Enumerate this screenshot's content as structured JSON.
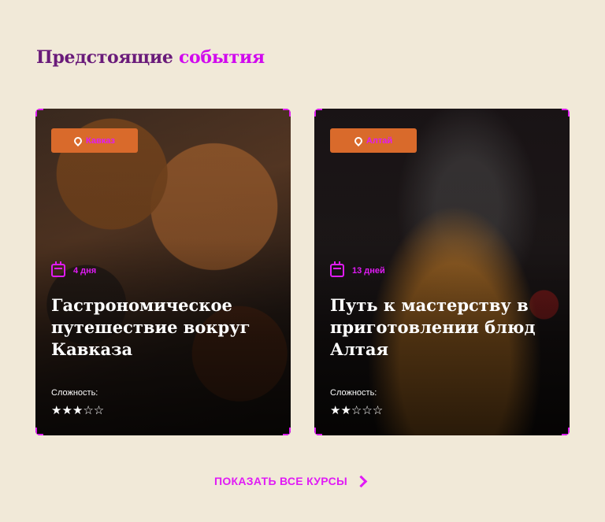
{
  "section": {
    "title_part1": "Предстоящие",
    "title_part2": "события"
  },
  "cards": [
    {
      "location": "Кавказ",
      "duration": "4 дня",
      "title": "Гастрономическое путешествие вокруг Кавказа",
      "difficulty_label": "Сложность:",
      "stars": "★★★☆☆",
      "difficulty_rating": 3
    },
    {
      "location": "Алтай",
      "duration": "13 дней",
      "title": "Путь к мастерству в приготовлении блюд Алтая",
      "difficulty_label": "Сложность:",
      "stars": "★★☆☆☆",
      "difficulty_rating": 2
    }
  ],
  "footer": {
    "show_all_label": "ПОКАЗАТЬ ВСЕ КУРСЫ"
  },
  "colors": {
    "background": "#f1e9d8",
    "accent": "#e01bf5",
    "title_dark": "#6a1b7a",
    "location_badge": "#d96a2b"
  }
}
